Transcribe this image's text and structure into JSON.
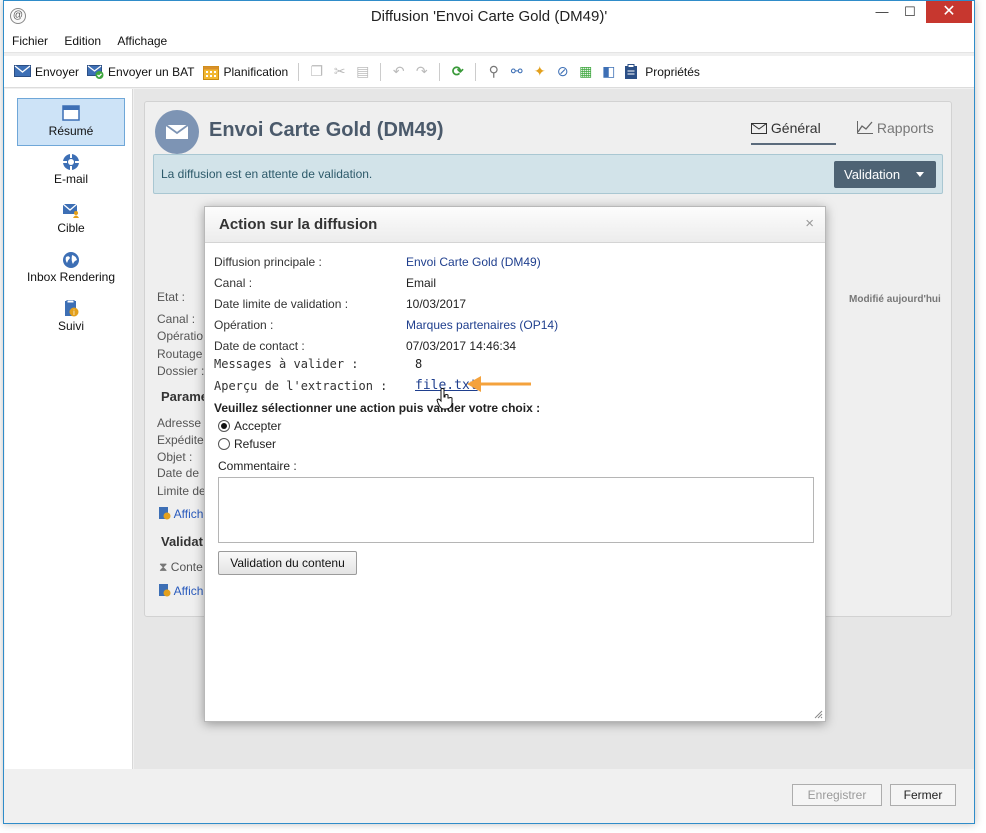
{
  "window": {
    "title": "Diffusion 'Envoi Carte Gold (DM49)'",
    "minimize": "—",
    "maximize": "☐",
    "close": "✕"
  },
  "menu": {
    "items": [
      "Fichier",
      "Edition",
      "Affichage"
    ]
  },
  "toolbar": {
    "send": "Envoyer",
    "send_proof": "Envoyer un BAT",
    "schedule": "Planification",
    "properties": "Propriétés"
  },
  "sidebar": {
    "items": [
      {
        "label": "Résumé",
        "icon": "summary-icon"
      },
      {
        "label": "E-mail",
        "icon": "email-icon"
      },
      {
        "label": "Cible",
        "icon": "target-icon"
      },
      {
        "label": "Inbox Rendering",
        "icon": "globe-icon"
      },
      {
        "label": "Suivi",
        "icon": "tracking-icon"
      }
    ]
  },
  "header": {
    "title": "Envoi Carte Gold (DM49)",
    "tab_general": "Général",
    "tab_reports": "Rapports"
  },
  "banner": {
    "message": "La diffusion est en attente de validation.",
    "button": "Validation"
  },
  "background": {
    "etat": "Etat :",
    "modified": "Modifié aujourd'hui",
    "canal": "Canal :",
    "operation": "Opératio",
    "routage": "Routage",
    "dossier": "Dossier :",
    "section_params": "Parame",
    "adresse": "Adresse",
    "expediteur": "Expédite",
    "objet": "Objet :",
    "date_de": "Date de",
    "limite": "Limite de",
    "link_afficher1": "Affich",
    "section_validation": "Validat",
    "contenu": "Conte",
    "link_afficher2": "Affich"
  },
  "footer": {
    "save": "Enregistrer",
    "close": "Fermer"
  },
  "dialog": {
    "title": "Action sur la diffusion",
    "close": "×",
    "rows": [
      {
        "label": "Diffusion principale :",
        "value": "Envoi Carte Gold (DM49)"
      },
      {
        "label": "Canal :",
        "value": "Email"
      },
      {
        "label": "Date limite de validation :",
        "value": "10/03/2017"
      },
      {
        "label": "Opération :",
        "value": "Marques partenaires (OP14)"
      },
      {
        "label": "Date de contact :",
        "value": "07/03/2017 14:46:34"
      }
    ],
    "messages_label": "Messages à valider :",
    "messages_value": "8",
    "extraction_label": "Aperçu de l'extraction :",
    "extraction_file": "file.txt",
    "instruction": "Veuillez sélectionner une action puis valider votre choix :",
    "option_accept": "Accepter",
    "option_refuse": "Refuser",
    "selected_option": "Accepter",
    "comment_label": "Commentaire :",
    "comment_value": "",
    "validate_content_button": "Validation du contenu"
  },
  "colors": {
    "accent": "#2f8cc9",
    "banner_bg": "#d2e3e9",
    "validation_button": "#4e6374",
    "arrow": "#f4a23c",
    "link": "#1f3f8e"
  }
}
